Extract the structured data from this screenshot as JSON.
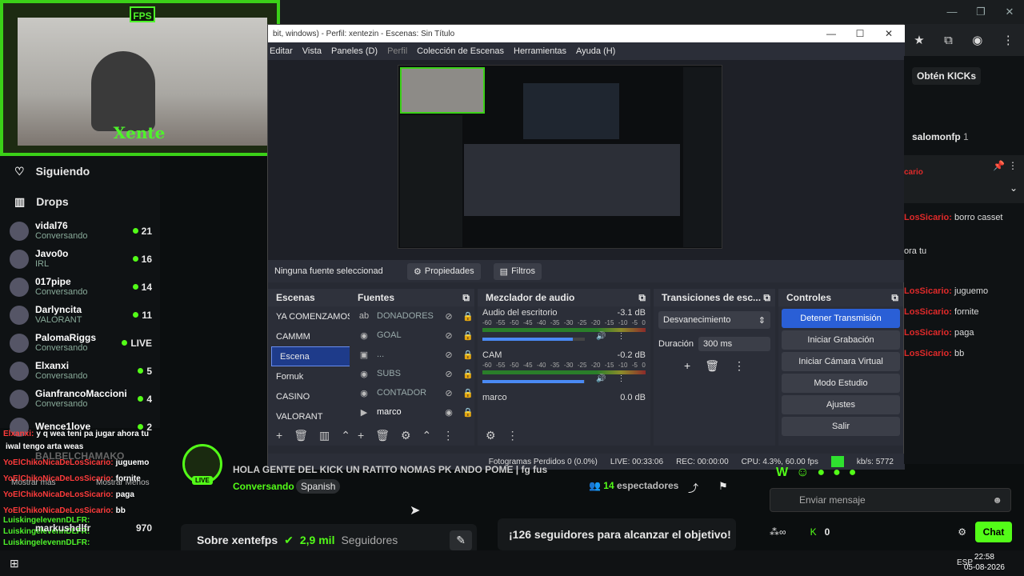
{
  "browser": {
    "win_buttons": [
      "—",
      "❐",
      "✕"
    ],
    "toolbar_icons": [
      "★",
      "⧉",
      "◉",
      "⋮"
    ]
  },
  "webcam": {
    "badge": "FPS",
    "logo": "Xente"
  },
  "sidebar": {
    "nav": [
      {
        "label": "Siguiendo",
        "icon": "heart-icon"
      },
      {
        "label": "Drops",
        "icon": "drops-icon"
      }
    ],
    "following": [
      {
        "name": "vidal76",
        "category": "Conversando",
        "count": "21"
      },
      {
        "name": "Javo0o",
        "category": "IRL",
        "count": "16"
      },
      {
        "name": "017pipe",
        "category": "Conversando",
        "count": "14"
      },
      {
        "name": "Darlyncita",
        "category": "VALORANT",
        "count": "11"
      },
      {
        "name": "PalomaRiggs",
        "category": "Conversando",
        "count": "LIVE"
      },
      {
        "name": "Elxanxi",
        "category": "Conversando",
        "count": "5"
      },
      {
        "name": "GianfrancoMaccioni",
        "category": "Conversando",
        "count": "4"
      },
      {
        "name": "Wence1love",
        "category": "",
        "count": "2"
      }
    ]
  },
  "obs": {
    "title": "bit, windows) - Perfil: xentezin - Escenas: Sin Título",
    "win_buttons": [
      "—",
      "☐",
      "✕"
    ],
    "menu": [
      "Editar",
      "Vista",
      "Paneles (D)",
      "Perfil",
      "Colección de Escenas",
      "Herramientas",
      "Ayuda (H)"
    ],
    "source_status": "Ninguna fuente seleccionad",
    "properties": "Propiedades",
    "filters": "Filtros",
    "scenes": {
      "title": "Escenas",
      "items": [
        "YA COMENZAMOS",
        "CAMMM",
        "Escena",
        "Fornuk",
        "CASINO",
        "VALORANT"
      ],
      "selected": "Escena"
    },
    "sources": {
      "title": "Fuentes",
      "items": [
        "DONADORES",
        "GOAL",
        "...",
        "SUBS",
        "CONTADOR",
        "marco"
      ]
    },
    "mixer": {
      "title": "Mezclador de audio",
      "scale": [
        "-60",
        "-55",
        "-50",
        "-45",
        "-40",
        "-35",
        "-30",
        "-25",
        "-20",
        "-15",
        "-10",
        "-5",
        "0"
      ],
      "channels": [
        {
          "name": "Audio del escritorio",
          "db": "-3.1 dB",
          "level": 0.88
        },
        {
          "name": "CAM",
          "db": "-0.2 dB",
          "level": 0.99
        },
        {
          "name": "marco",
          "db": "0.0 dB",
          "level": 1.0
        }
      ]
    },
    "transitions": {
      "title": "Transiciones de esc...",
      "type": "Desvanecimiento",
      "duration_label": "Duración",
      "duration": "300 ms"
    },
    "controls": {
      "title": "Controles",
      "buttons": [
        "Detener Transmisión",
        "Iniciar Grabación",
        "Iniciar Cámara Virtual",
        "Modo Estudio",
        "Ajustes",
        "Salir"
      ]
    },
    "status": {
      "dropped": "Fotogramas Perdidos 0 (0.0%)",
      "live": "LIVE: 00:33:06",
      "rec": "REC: 00:00:00",
      "cpu": "CPU: 4.3%, 60.00 fps",
      "kbps": "kb/s: 5772"
    }
  },
  "chat": {
    "promo": "Obtén KICKs",
    "pinned_user": "salomonfp",
    "pinned_count": "1",
    "pinned_red": "cario",
    "lines": [
      {
        "name": "LosSicario:",
        "text": " borro casset"
      },
      {
        "name": "",
        "text": "ora tu"
      },
      {
        "name": "LosSicario:",
        "text": " juguemo"
      },
      {
        "name": "LosSicario:",
        "text": " fornite"
      },
      {
        "name": "LosSicario:",
        "text": " paga"
      },
      {
        "name": "LosSicario:",
        "text": " bb"
      }
    ],
    "input_placeholder": "Enviar mensaje",
    "kicks": "0",
    "chat_button": "Chat"
  },
  "overlay_chat": [
    {
      "name": "Elxanxi:",
      "text": "y q wea teni pa jugar ahora tu"
    },
    {
      "name": "",
      "text": "iwal tengo arta weas"
    },
    {
      "name": "YoElChikoNicaDeLosSicario:",
      "text": "juguemo"
    },
    {
      "name": "YoElChikoNicaDeLosSicario:",
      "text": "fornite"
    },
    {
      "name": "YoElChikoNicaDeLosSicario:",
      "text": "paga"
    },
    {
      "name": "YoElChikoNicaDeLosSicario:",
      "text": "bb"
    },
    {
      "name": "LuiskingelevennDLFR:",
      "text": ""
    },
    {
      "name": "LuiskingelevennDLFR:",
      "text": ""
    },
    {
      "name": "LuiskingelevennDLFR:",
      "text": ""
    },
    {
      "name": "LuiskingelevennDLFR:",
      "text": ""
    }
  ],
  "overlay_misc": {
    "more": "Mostrar más",
    "less": "Mostrar Menos",
    "mark": "markushdlfr",
    "mark_count": "970",
    "balbel": "BALBELCHAMAKO"
  },
  "stream": {
    "title": "HOLA GENTE DEL KICK UN RATITO NOMAS PK ANDO POME | fg fus",
    "category": "Conversando",
    "language": "Spanish",
    "viewers": "14",
    "viewers_label": "espectadores",
    "live_badge": "LIVE"
  },
  "channel": {
    "about": "Sobre xentefps",
    "followers": "2,9 mil",
    "followers_label": "Seguidores"
  },
  "goal": "¡126 seguidores para alcanzar el objetivo!",
  "taskbar": {
    "lang": "ESP",
    "time": "22:58",
    "date": "05-08-2026"
  }
}
